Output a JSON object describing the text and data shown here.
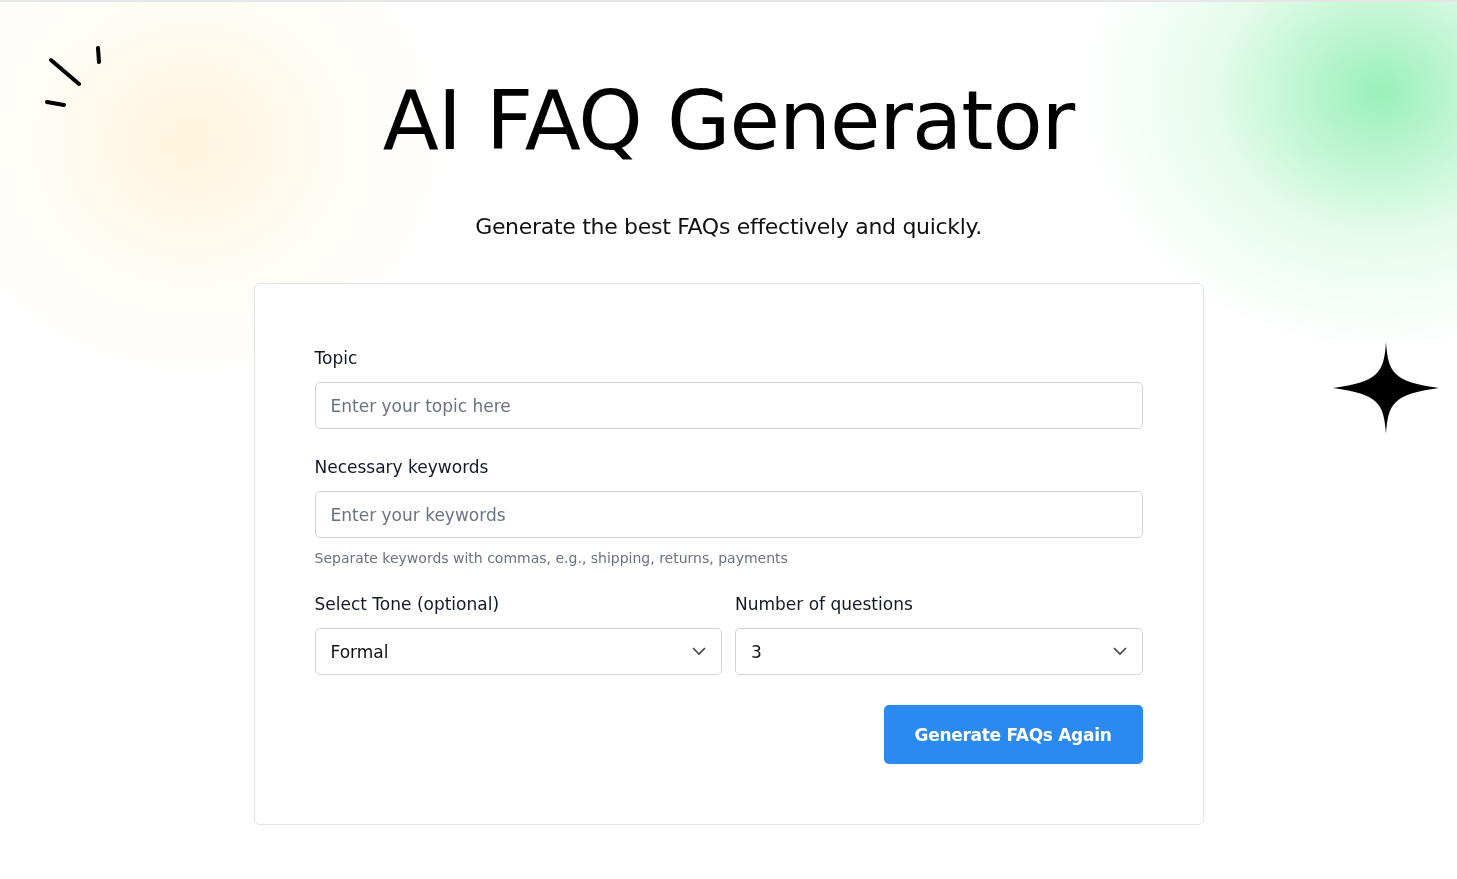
{
  "header": {
    "title": "AI FAQ Generator",
    "subtitle": "Generate the best FAQs effectively and quickly."
  },
  "form": {
    "fields": [
      {
        "kind": "text",
        "label": "Topic",
        "placeholder": "Enter your topic here"
      },
      {
        "kind": "text",
        "label": "Necessary keywords",
        "placeholder": "Enter your keywords",
        "hint": "Separate keywords with commas, e.g., shipping, returns, payments"
      },
      {
        "kind": "select",
        "label": "Select Tone (optional)",
        "value": "Formal"
      },
      {
        "kind": "select",
        "label": "Number of questions",
        "value": "3"
      }
    ],
    "submit": "Generate FAQs Again"
  }
}
